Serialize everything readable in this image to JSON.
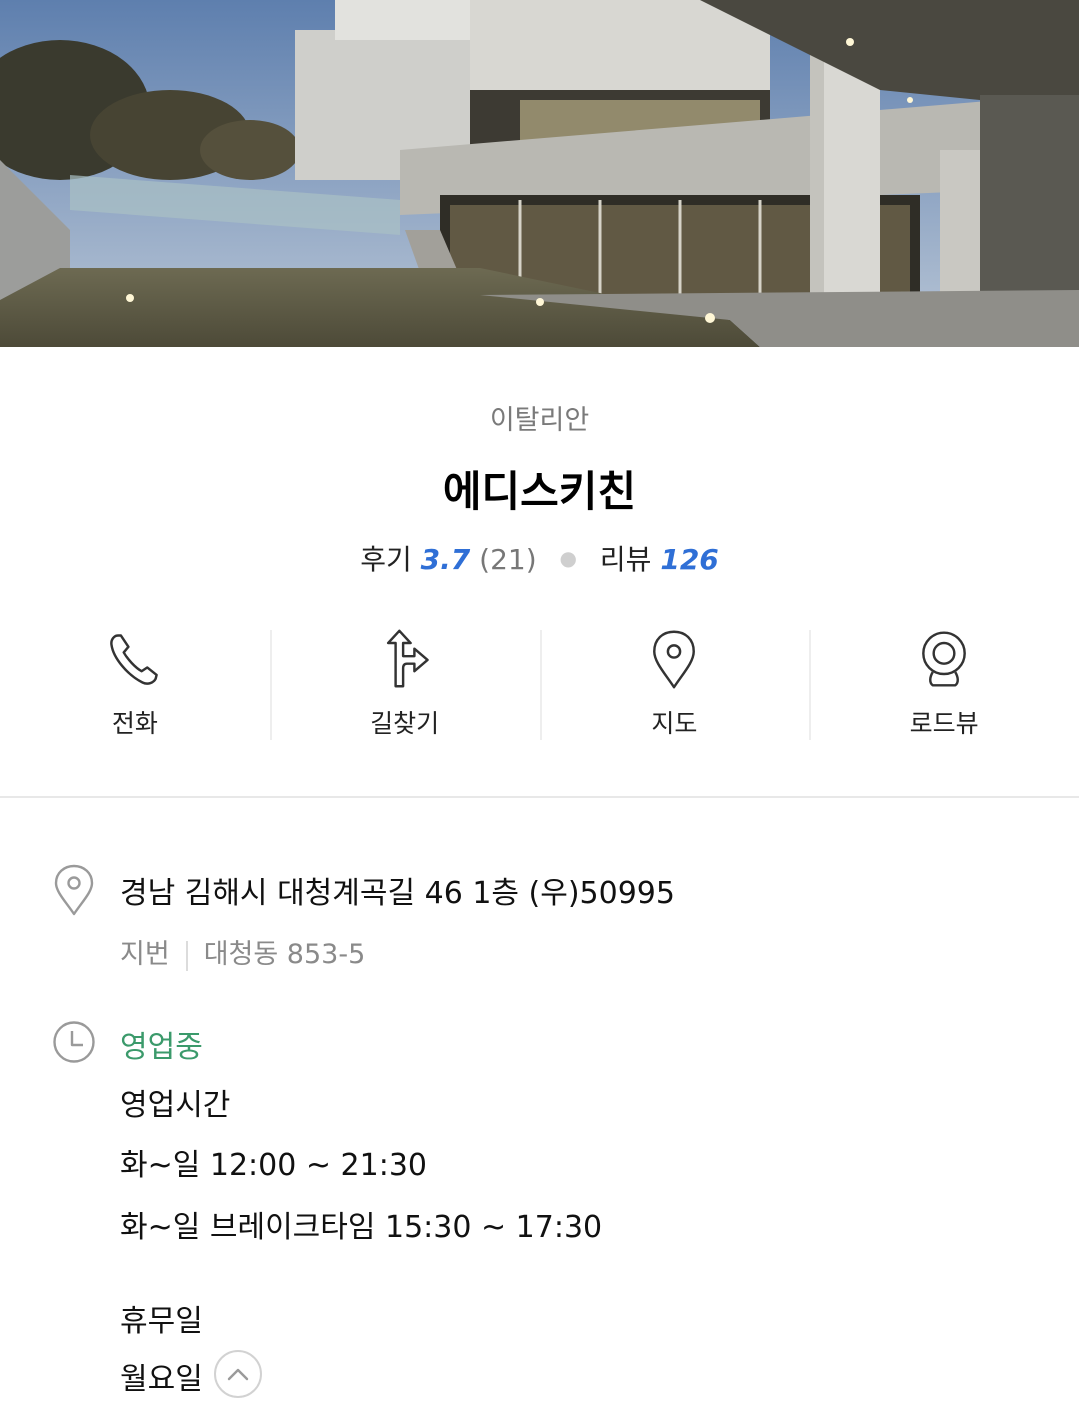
{
  "place": {
    "category": "이탈리안",
    "name": "에디스키친"
  },
  "ratings": {
    "review_label": "후기",
    "review_score": "3.7",
    "review_count": "(21)",
    "blog_label": "리뷰",
    "blog_count": "126"
  },
  "actions": [
    {
      "label": "전화",
      "icon": "phone-icon"
    },
    {
      "label": "길찾기",
      "icon": "directions-icon"
    },
    {
      "label": "지도",
      "icon": "map-pin-icon"
    },
    {
      "label": "로드뷰",
      "icon": "roadview-camera-icon"
    }
  ],
  "address": {
    "road": "경남 김해시 대청계곡길 46 1층 (우)50995",
    "jibun_label": "지번",
    "jibun": "대청동 853-5"
  },
  "hours": {
    "status": "영업중",
    "title": "영업시간",
    "line1": "화~일 12:00 ~ 21:30",
    "line2": "화~일 브레이크타임 15:30 ~ 17:30",
    "closed_title": "휴무일",
    "closed_day": "월요일"
  },
  "colors": {
    "accent_blue": "#2f6fd6",
    "open_green": "#3b9a6b"
  }
}
